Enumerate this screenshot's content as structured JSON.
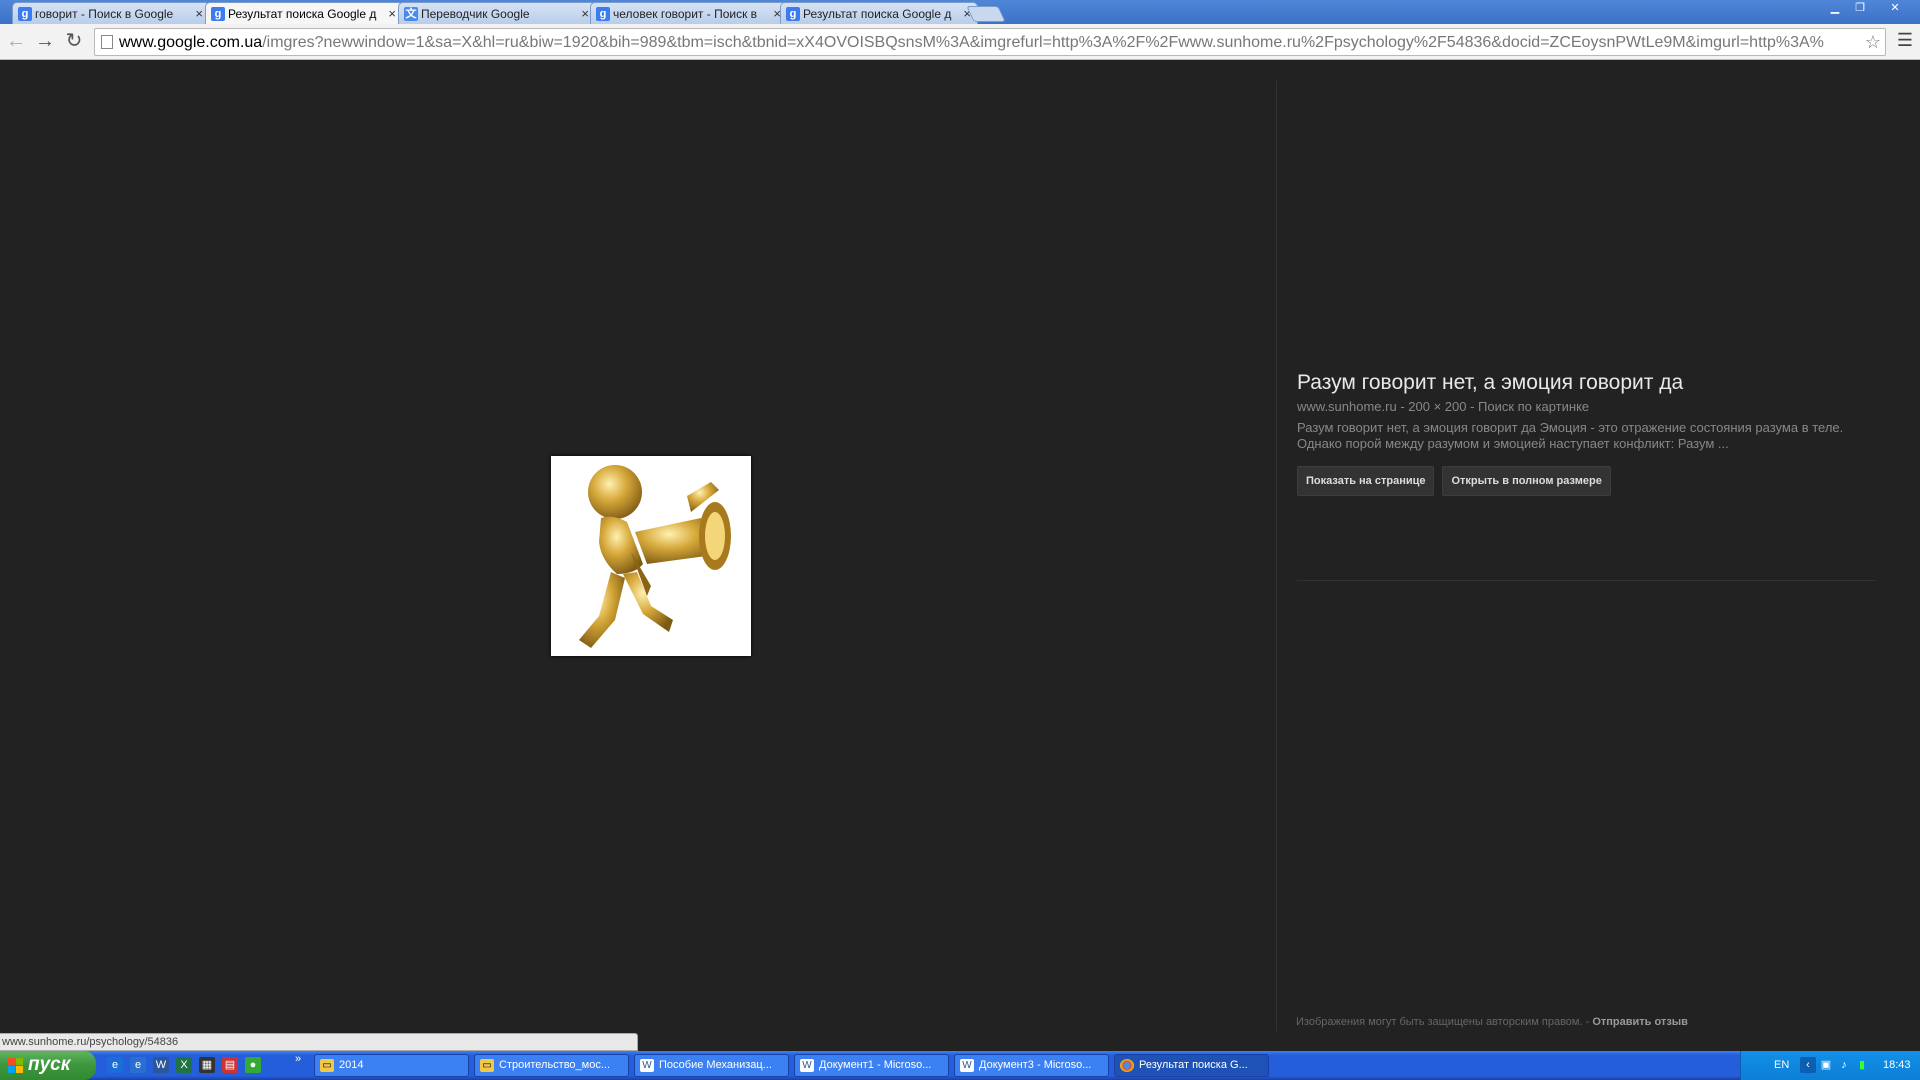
{
  "tabs": [
    {
      "label": "говорит - Поиск в Google",
      "icon": "google-icon",
      "active": false
    },
    {
      "label": "Результат поиска Google д",
      "icon": "google-icon",
      "active": true
    },
    {
      "label": "Переводчик Google",
      "icon": "translate-icon",
      "active": false
    },
    {
      "label": "человек говорит - Поиск в",
      "icon": "google-icon",
      "active": false
    },
    {
      "label": "Результат поиска Google д",
      "icon": "google-icon",
      "active": false
    }
  ],
  "address": {
    "host": "www.google.com.ua",
    "path": "/imgres?newwindow=1&sa=X&hl=ru&biw=1920&bih=989&tbm=isch&tbnid=xX4OVOISBQsnsM%3A&imgrefurl=http%3A%2F%2Fwww.sunhome.ru%2Fpsychology%2F54836&docid=ZCEoysnPWtLe9M&imgurl=http%3A%"
  },
  "image_panel": {
    "title": "Разум говорит нет, а эмоция говорит да",
    "meta": "www.sunhome.ru - 200 × 200 - Поиск по картинке",
    "description": "Разум говорит нет, а эмоция говорит да Эмоция - это отражение состояния разума в теле. Однако порой между разумом и эмоцией наступает конфликт: Разум ...",
    "show_on_page": "Показать на странице",
    "open_full": "Открыть в полном размере"
  },
  "footer": {
    "notice": "Изображения могут быть защищены авторским правом.",
    "separator": " - ",
    "feedback": "Отправить отзыв"
  },
  "status_url": "www.sunhome.ru/psychology/54836",
  "taskbar": {
    "start_label": "пуск",
    "tasks": [
      {
        "label": "2014",
        "icon": "folder-icon",
        "active": false
      },
      {
        "label": "Строительство_мос...",
        "icon": "folder-icon",
        "active": false
      },
      {
        "label": "Пособие Механизац...",
        "icon": "word-icon",
        "active": false
      },
      {
        "label": "Документ1 - Microso...",
        "icon": "word-icon",
        "active": false
      },
      {
        "label": "Документ3 - Microso...",
        "icon": "word-icon",
        "active": false
      },
      {
        "label": "Результат поиска G...",
        "icon": "chrome-icon",
        "active": true
      }
    ],
    "lang": "EN",
    "clock": "18:43"
  }
}
